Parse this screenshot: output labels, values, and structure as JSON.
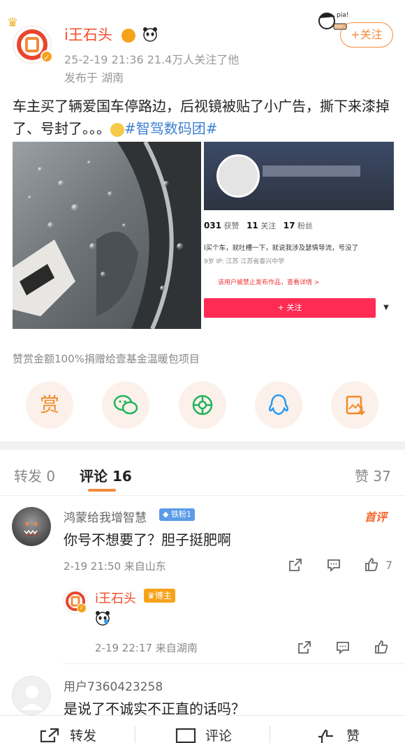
{
  "post": {
    "author": "i王石头",
    "meta_line": "25-2-19 21:36  21.4万人关注了他",
    "location_line": "发布于 湖南",
    "follow_label": "+关注",
    "text_main": "车主买了辆爱国车停路边，后视镜被贴了小广告，撕下来漆掉了、号封了。。。",
    "text_tag": "#智驾数码团#",
    "donate_text": "赞赏金额100%捐赠给壹基金温暖包项目",
    "reward_label": "赏",
    "image2": {
      "stats": [
        {
          "value": "031",
          "label": "获赞"
        },
        {
          "value": "11",
          "label": "关注"
        },
        {
          "value": "17",
          "label": "粉丝"
        }
      ],
      "bio": "l买个车，就吐槽一下，就说我涉及瑟情导流，号没了",
      "info": "9岁  IP: 江苏  江苏省泰兴中学",
      "warning": "该用户被禁止发布作品，查看详情 >",
      "follow": "+ 关注"
    }
  },
  "tabs": {
    "repost": "转发 0",
    "comment": "评论 16",
    "like": "赞 37"
  },
  "comments": [
    {
      "name": "鸿蒙给我增智慧",
      "badge": "铁粉1",
      "tag": "首评",
      "text": "你号不想要了？胆子挺肥啊",
      "time": "2-19 21:50  来自山东",
      "likes": "7"
    },
    {
      "name": "i王石头",
      "badge": "博主",
      "text": "",
      "time": "2-19 22:17  来自湖南"
    },
    {
      "name": "用户7360423258",
      "text": "是说了不诚实不正直的话吗？"
    }
  ],
  "bottom": {
    "repost": "转发",
    "comment": "评论",
    "like": "赞"
  }
}
